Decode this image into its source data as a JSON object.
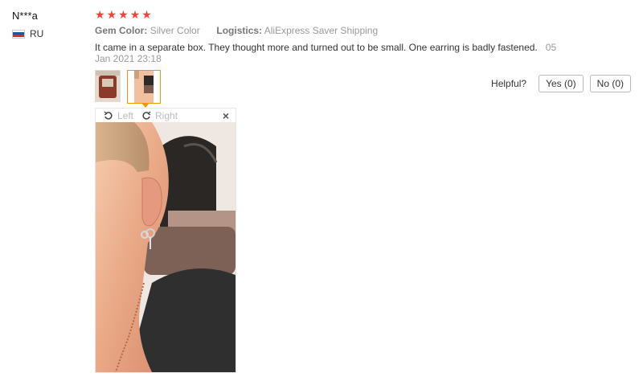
{
  "user": {
    "name": "N***a",
    "country": "RU"
  },
  "rating": {
    "stars": 5,
    "star_char": "★"
  },
  "attributes": [
    {
      "label": "Gem Color:",
      "value": "Silver Color"
    },
    {
      "label": "Logistics:",
      "value": "AliExpress Saver Shipping"
    }
  ],
  "review": {
    "text": "It came in a separate box. They thought more and turned out to be small. One earring is badly fastened.",
    "date": "05 Jan 2021 23:18"
  },
  "helpful": {
    "question": "Helpful?",
    "yes_label": "Yes (0)",
    "no_label": "No (0)"
  },
  "viewer": {
    "left_label": "Left",
    "right_label": "Right",
    "close_symbol": "×"
  },
  "thumbnails": [
    "photo-1",
    "photo-2"
  ],
  "colors": {
    "star": "#f44336",
    "active_border": "#f39800"
  },
  "icons": {
    "rotate_left": "rotate-left-icon",
    "rotate_right": "rotate-right-icon",
    "close": "close-icon",
    "flag": "russia-flag-icon"
  }
}
